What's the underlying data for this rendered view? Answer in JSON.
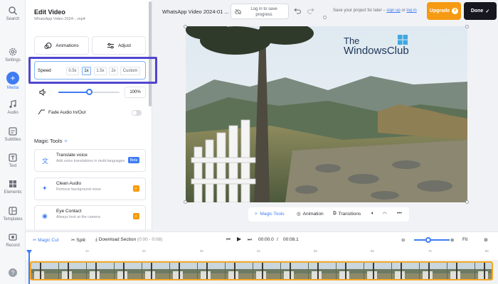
{
  "rail": {
    "items": [
      {
        "label": "Search",
        "icon": "search-icon"
      },
      {
        "label": "Settings",
        "icon": "gear-icon"
      },
      {
        "label": "Media",
        "icon": "plus-icon",
        "active": true
      },
      {
        "label": "Audio",
        "icon": "music-note-icon"
      },
      {
        "label": "Subtitles",
        "icon": "subtitles-icon"
      },
      {
        "label": "Text",
        "icon": "text-icon"
      },
      {
        "label": "Elements",
        "icon": "shapes-icon"
      },
      {
        "label": "Templates",
        "icon": "templates-icon"
      },
      {
        "label": "Record",
        "icon": "record-icon"
      },
      {
        "label": "",
        "icon": "help-icon"
      }
    ]
  },
  "panel": {
    "title": "Edit Video",
    "subtitle": "WhatsApp Video 2024-...mp4",
    "animations_label": "Animations",
    "adjust_label": "Adjust",
    "speed": {
      "label": "Speed",
      "options": [
        "0.5x",
        "1x",
        "1.5x",
        "2x",
        "Custom"
      ],
      "selected": "1x"
    },
    "volume": {
      "value": "100%",
      "level": 0.5
    },
    "fade_label": "Fade Audio In/Out",
    "fade_enabled": false,
    "magic_tools_title": "Magic Tools",
    "magic_tools": [
      {
        "title": "Translate voice",
        "desc": "Add voice translations in multi-languages",
        "badge": "Beta",
        "badge_color": "#3f7cf4"
      },
      {
        "title": "Clean Audio",
        "desc": "Remove background noise",
        "badge": "⚡",
        "badge_color": "#f59a12"
      },
      {
        "title": "Eye Contact",
        "desc": "Always look at the camera",
        "badge": "⚡",
        "badge_color": "#f59a12"
      }
    ]
  },
  "topbar": {
    "file_name": "WhatsApp Video 2024-01 ...",
    "login_line1": "Log in to save",
    "login_line2": "progress",
    "save_prefix": "Save your project for later – ",
    "sign_up": "sign up",
    "or": " or ",
    "log_in": "log in",
    "upgrade_label": "Upgrade",
    "done_label": "Done"
  },
  "canvas": {
    "watermark_line1": "The",
    "watermark_line2": "WindowsClub",
    "toolbar": {
      "magic_tools": "Magic Tools",
      "animation": "Animation",
      "transitions": "Transitions"
    }
  },
  "timeline": {
    "magic_cut": "Magic Cut",
    "split": "Split",
    "download_section": "Download Section",
    "section_range": "(0:00 - 0:08)",
    "current_time": "00:00.0",
    "separator": "/",
    "total_time": "00:08.1",
    "fit_label": "Fit",
    "ruler": [
      "1s",
      "2s",
      "3s",
      "4s",
      "5s",
      "6s",
      "7s",
      "8s"
    ]
  },
  "colors": {
    "accent": "#3f7cf4",
    "upgrade": "#f59a12",
    "done": "#15181e",
    "highlight": "#5145cf",
    "track_border": "#f5a623"
  }
}
